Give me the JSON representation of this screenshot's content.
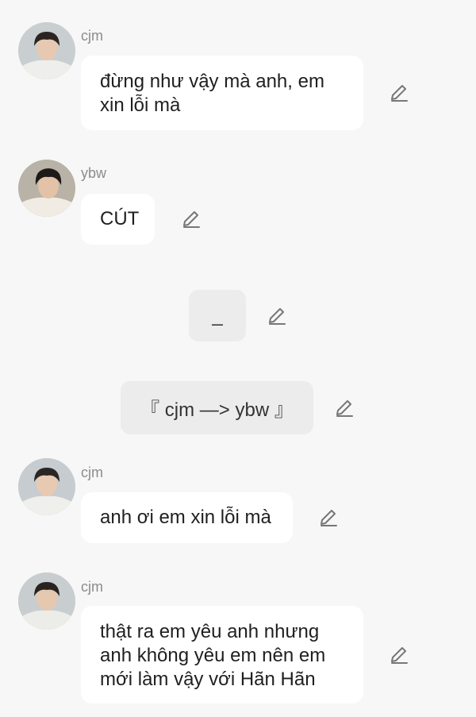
{
  "messages": [
    {
      "sender": "cjm",
      "text": "đừng như vậy mà anh, em\nxin lỗi mà"
    },
    {
      "sender": "ybw",
      "text": "CÚT"
    },
    {
      "system": "_"
    },
    {
      "system": "『 cjm —> ybw 』"
    },
    {
      "sender": "cjm",
      "text": "anh ơi em xin lỗi mà"
    },
    {
      "sender": "cjm",
      "text": "thật ra em yêu anh nhưng\nanh không yêu em nên em\nmới làm vậy với Hãn Hãn"
    }
  ],
  "icons": {
    "avatar": "user-photo-avatar",
    "edit": "pencil-edit-icon"
  }
}
